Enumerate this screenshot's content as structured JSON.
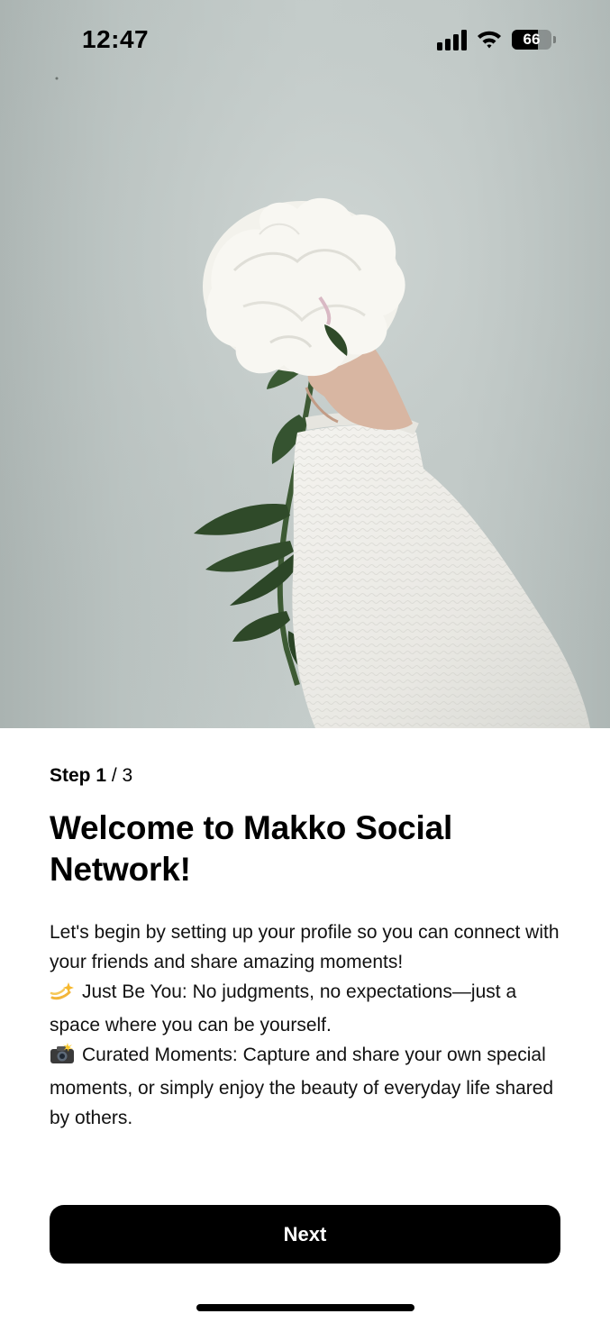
{
  "status_bar": {
    "time": "12:47",
    "battery_level": "66",
    "battery_fraction": 0.66,
    "icons": [
      "cellular-signal-icon",
      "wifi-icon",
      "battery-icon"
    ]
  },
  "hero": {
    "image": "white-peony-held-in-hand-photo"
  },
  "onboarding": {
    "step_current": "Step 1",
    "step_separator": " / ",
    "step_total": "3",
    "title": "Welcome to Makko Social Network!",
    "intro": "Let's begin by setting up your profile so you can connect with your friends and share amazing moments!",
    "feature_1": "Just Be You: No judgments, no expectations—just a space where you can be yourself.",
    "feature_1_icon": "dizzy-star-emoji",
    "feature_2": "Curated Moments: Capture and share your own special moments, or simply enjoy the beauty of everyday life shared by others.",
    "feature_2_icon": "camera-flash-emoji"
  },
  "actions": {
    "next_label": "Next"
  },
  "colors": {
    "button_bg": "#000000",
    "button_text": "#ffffff",
    "background": "#ffffff"
  }
}
